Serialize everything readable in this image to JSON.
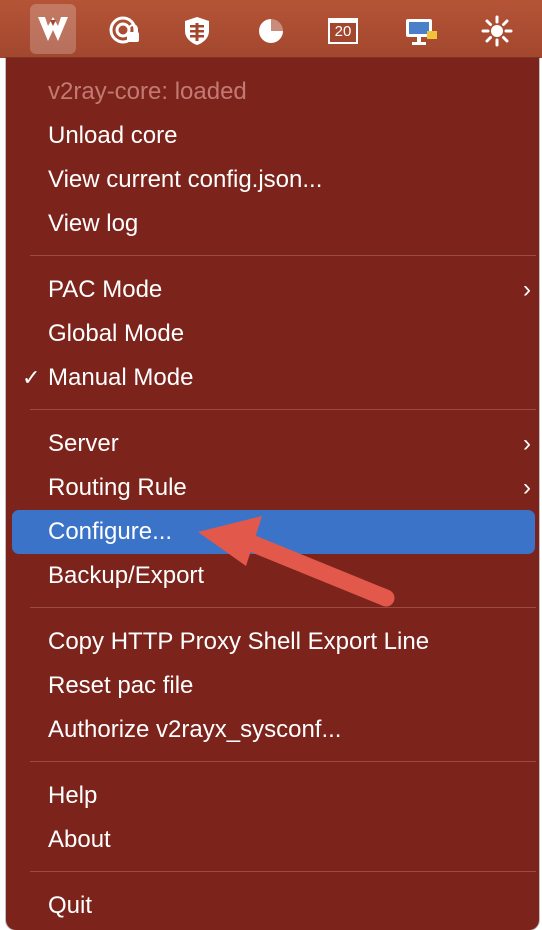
{
  "menubar": {
    "icons": [
      {
        "name": "v2rayx-icon"
      },
      {
        "name": "vpn-status-icon"
      },
      {
        "name": "shield-icon"
      },
      {
        "name": "pie-chart-icon"
      },
      {
        "name": "calendar-icon",
        "text": "20"
      },
      {
        "name": "display-icon"
      },
      {
        "name": "brightness-icon"
      }
    ]
  },
  "menu": {
    "status": "v2ray-core: loaded",
    "unload_core": "Unload core",
    "view_config": "View current config.json...",
    "view_log": "View log",
    "pac_mode": "PAC Mode",
    "global_mode": "Global Mode",
    "manual_mode": "Manual Mode",
    "checkmark": "✓",
    "server": "Server",
    "routing_rule": "Routing Rule",
    "configure": "Configure...",
    "backup_export": "Backup/Export",
    "copy_proxy": "Copy HTTP Proxy Shell Export Line",
    "reset_pac": "Reset pac file",
    "authorize": "Authorize v2rayx_sysconf...",
    "help": "Help",
    "about": "About",
    "quit": "Quit",
    "chevron": "›"
  },
  "colors": {
    "menubar": "#a2472e",
    "menu_bg": "#7c241c",
    "highlight": "#3b73c9",
    "arrow": "#e2584a"
  }
}
